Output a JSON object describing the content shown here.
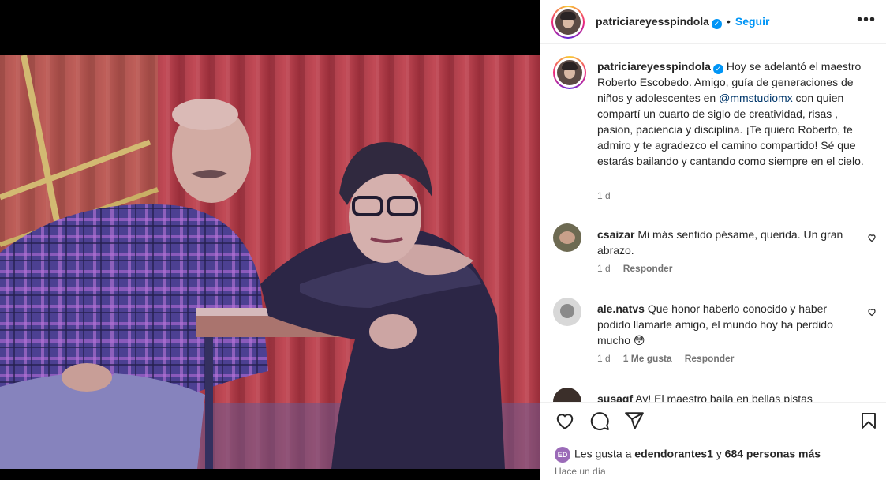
{
  "post": {
    "username": "patriciareyesspindola",
    "verified_icon": "verified-badge-icon",
    "follow_label": "Seguir",
    "more_icon": "more-options-icon",
    "caption_before": "Hoy se adelantó el maestro Roberto Escobedo. Amigo, guía de generaciones de niños y adolescentes en ",
    "caption_mention": "@mmstudiomx",
    "caption_after": " con quien compartí un cuarto de siglo de creatividad, risas , pasion, paciencia y disciplina. ¡Te quiero Roberto, te admiro y te agradezco el camino compartido! Sé que estarás bailando y cantando como siempre en el cielo.",
    "caption_time": "1 d"
  },
  "comments": [
    {
      "username": "csaizar",
      "text": "Mi más sentido pésame, querida. Un gran abrazo.",
      "time": "1 d",
      "likes": "",
      "reply_label": "Responder"
    },
    {
      "username": "ale.natvs",
      "text": "Que honor haberlo conocido y haber podido llamarle amigo, el mundo hoy ha perdido mucho 😳",
      "time": "1 d",
      "likes": "1 Me gusta",
      "reply_label": "Responder"
    },
    {
      "username": "susagf",
      "text": "Ay! El maestro baila en bellas pistas"
    }
  ],
  "actions": {
    "like_icon": "heart-icon",
    "comment_icon": "comment-icon",
    "share_icon": "share-icon",
    "save_icon": "bookmark-icon"
  },
  "likes": {
    "avatar_text": "ED",
    "prefix": "Les gusta a ",
    "first_user": "edendorantes1",
    "middle": " y ",
    "others": "684 personas más"
  },
  "posted_ago": "Hace un día",
  "colors": {
    "accent": "#0095f6",
    "text": "#262626",
    "muted": "#737373",
    "mention": "#00376b"
  }
}
